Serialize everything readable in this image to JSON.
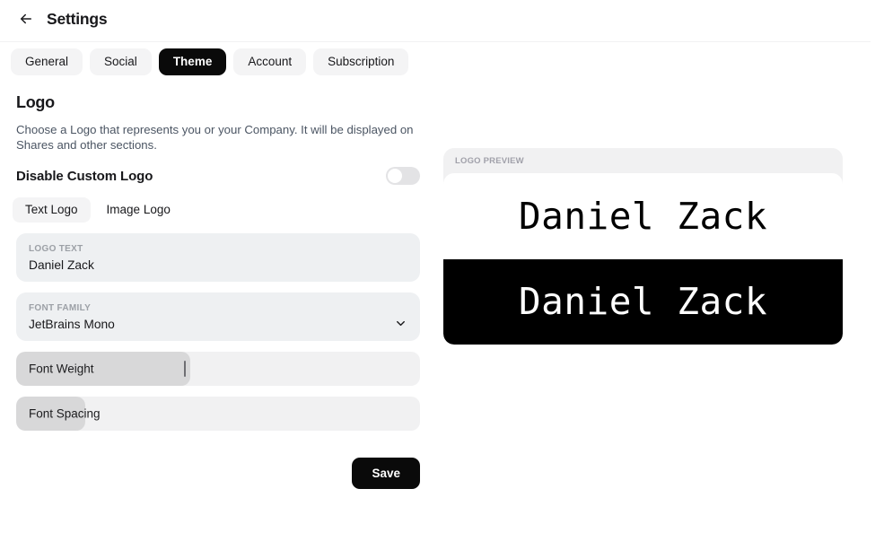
{
  "header": {
    "back_icon": "arrow-left-icon",
    "title": "Settings"
  },
  "tabs": [
    {
      "label": "General",
      "active": false
    },
    {
      "label": "Social",
      "active": false
    },
    {
      "label": "Theme",
      "active": true
    },
    {
      "label": "Account",
      "active": false
    },
    {
      "label": "Subscription",
      "active": false
    }
  ],
  "logo_section": {
    "title": "Logo",
    "description": "Choose a Logo that represents you or your Company. It will be displayed on Shares and other sections.",
    "toggle": {
      "label": "Disable Custom Logo",
      "state": "off"
    },
    "logo_type_tabs": [
      {
        "label": "Text Logo",
        "active": true
      },
      {
        "label": "Image Logo",
        "active": false
      }
    ],
    "logo_text_field": {
      "label": "LOGO TEXT",
      "value": "Daniel Zack",
      "placeholder": "Daniel Zack"
    },
    "font_family_field": {
      "label": "FONT FAMILY",
      "value": "JetBrains Mono",
      "chevron_icon": "chevron-down-icon"
    },
    "font_weight_slider": {
      "label": "Font Weight",
      "fill_percent": 43
    },
    "font_spacing_slider": {
      "label": "Font Spacing",
      "fill_percent": 17
    },
    "save_label": "Save"
  },
  "preview": {
    "header_label": "LOGO PREVIEW",
    "light_text": "Daniel Zack",
    "dark_text": "Daniel Zack"
  }
}
